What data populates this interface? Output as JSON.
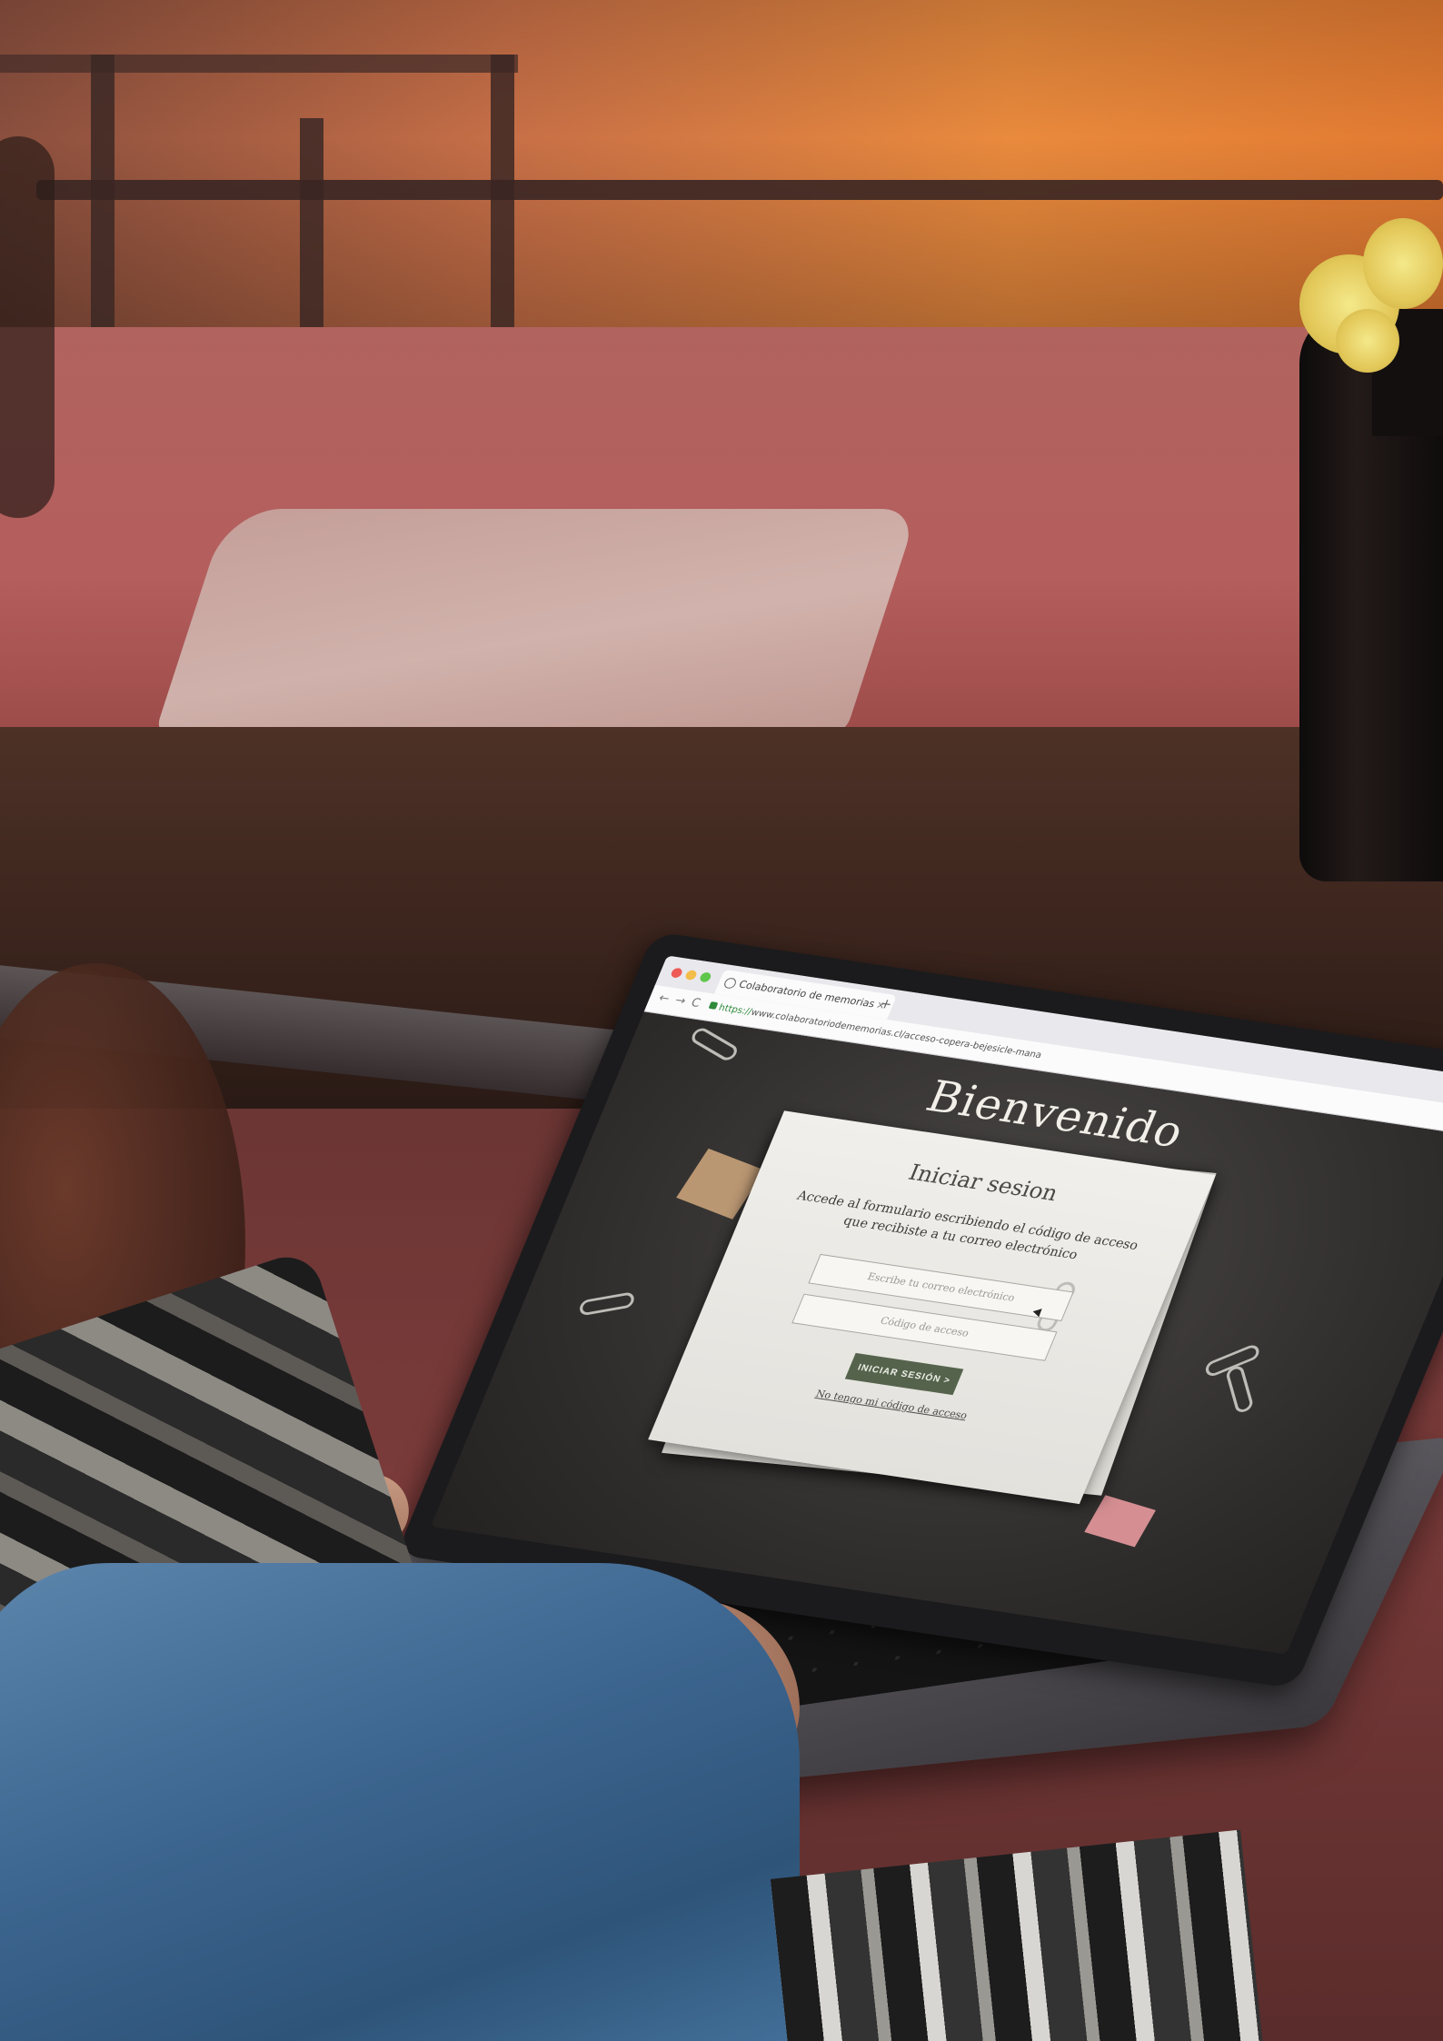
{
  "browser": {
    "tab_title": "Colaboratorio de memorias",
    "tab_close": "×",
    "new_tab": "+",
    "nav_back": "←",
    "nav_forward": "→",
    "nav_reload": "C",
    "url_scheme": "https://",
    "url_rest": "www.colaboratoriodememorias.cl/acceso-copera-bejesicle-mana"
  },
  "page": {
    "welcome": "Bienvenido",
    "card_title": "Iniciar sesion",
    "card_description": "Accede al formulario escribiendo el código de acceso que recibiste a tu correo electrónico",
    "email_placeholder": "Escribe tu correo electrónico",
    "code_placeholder": "Código de acceso",
    "login_button": "INICIAR SESIÓN  >",
    "no_code_link": "No tengo mi código de acceso"
  },
  "colors": {
    "button_bg": "#55634c",
    "screen_bg": "#2e2c2b",
    "paper_bg": "#f0efeb"
  }
}
